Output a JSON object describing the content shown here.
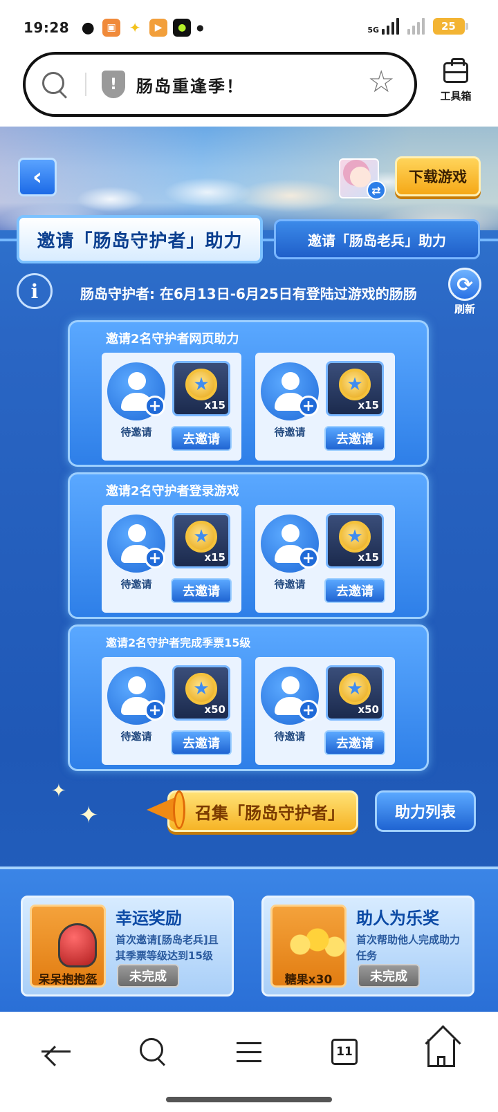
{
  "status_bar": {
    "time": "19:28",
    "network": "5G",
    "battery": "25",
    "app_icons": [
      "wechat-icon",
      "app-orange-icon",
      "app-yellow-icon",
      "app-video-icon",
      "app-green-icon"
    ]
  },
  "browser": {
    "page_title": "肠岛重逢季！",
    "toolbox_label": "工具箱"
  },
  "game": {
    "download_label": "下载游戏",
    "tabs": [
      {
        "label": "邀请「肠岛守护者」助力",
        "active": true
      },
      {
        "label": "邀请「肠岛老兵」助力",
        "active": false
      }
    ],
    "info_text": "肠岛守护者: 在6月13日-6月25日有登陆过游戏的肠肠",
    "refresh_label": "刷新",
    "tasks": [
      {
        "title": "邀请2名守护者网页助力",
        "slots": [
          {
            "status": "待邀请",
            "qty": "x15",
            "button": "去邀请"
          },
          {
            "status": "待邀请",
            "qty": "x15",
            "button": "去邀请"
          }
        ]
      },
      {
        "title": "邀请2名守护者登录游戏",
        "slots": [
          {
            "status": "待邀请",
            "qty": "x15",
            "button": "去邀请"
          },
          {
            "status": "待邀请",
            "qty": "x15",
            "button": "去邀请"
          }
        ]
      },
      {
        "title": "邀请2名守护者完成季票15级",
        "slots": [
          {
            "status": "待邀请",
            "qty": "x50",
            "button": "去邀请"
          },
          {
            "status": "待邀请",
            "qty": "x50",
            "button": "去邀请"
          }
        ]
      }
    ],
    "gather_label": "召集「肠岛守护者」",
    "aid_list_label": "助力列表",
    "rewards": [
      {
        "title": "幸运奖励",
        "desc": "首次邀请[肠岛老兵]且其季票等级达到15级",
        "item": "呆呆抱抱盔",
        "status": "未完成"
      },
      {
        "title": "助人为乐奖",
        "desc": "首次帮助他人完成助力任务",
        "item": "糖果x30",
        "status": "未完成"
      }
    ]
  },
  "nav": {
    "tab_count": "11"
  },
  "colors": {
    "accent_blue": "#2a6fd6",
    "accent_gold": "#f6b426"
  }
}
